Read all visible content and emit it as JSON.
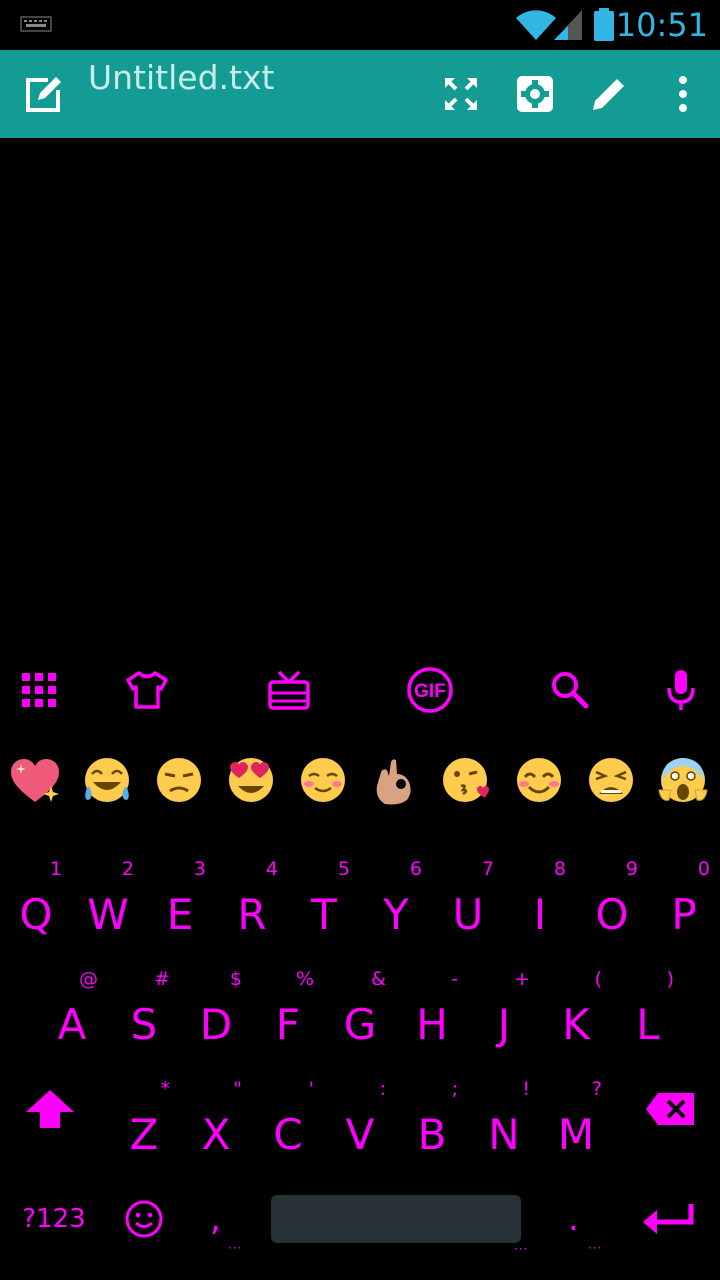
{
  "status": {
    "time": "10:51"
  },
  "app": {
    "title": "Untitled.txt"
  },
  "keyboard": {
    "tools": [
      "grid-icon",
      "shirt-icon",
      "gift-icon",
      "gif-icon",
      "search-icon",
      "mic-icon"
    ],
    "gif_label": "GIF",
    "row1": [
      {
        "k": "Q",
        "h": "1"
      },
      {
        "k": "W",
        "h": "2"
      },
      {
        "k": "E",
        "h": "3"
      },
      {
        "k": "R",
        "h": "4"
      },
      {
        "k": "T",
        "h": "5"
      },
      {
        "k": "Y",
        "h": "6"
      },
      {
        "k": "U",
        "h": "7"
      },
      {
        "k": "I",
        "h": "8"
      },
      {
        "k": "O",
        "h": "9"
      },
      {
        "k": "P",
        "h": "0"
      }
    ],
    "row2": [
      {
        "k": "A",
        "h": "@"
      },
      {
        "k": "S",
        "h": "#"
      },
      {
        "k": "D",
        "h": "$"
      },
      {
        "k": "F",
        "h": "%"
      },
      {
        "k": "G",
        "h": "&"
      },
      {
        "k": "H",
        "h": "-"
      },
      {
        "k": "J",
        "h": "+"
      },
      {
        "k": "K",
        "h": "("
      },
      {
        "k": "L",
        "h": ")"
      }
    ],
    "row3": [
      {
        "k": "Z",
        "h": "*"
      },
      {
        "k": "X",
        "h": "\""
      },
      {
        "k": "C",
        "h": "'"
      },
      {
        "k": "V",
        "h": ":"
      },
      {
        "k": "B",
        "h": ";"
      },
      {
        "k": "N",
        "h": "!"
      },
      {
        "k": "M",
        "h": "?"
      }
    ],
    "symbols_label": "?123",
    "comma": ",",
    "period": ".",
    "accent": "#ff00ff"
  }
}
